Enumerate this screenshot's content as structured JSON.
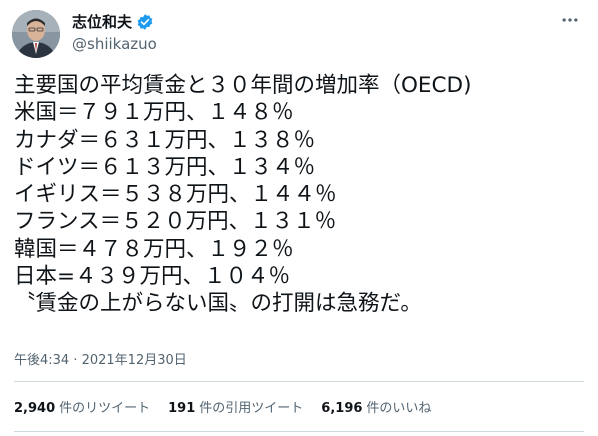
{
  "author": {
    "display_name": "志位和夫",
    "handle": "@shiikazuo",
    "verified_badge_color": "#1d9bf0",
    "avatar": "user-portrait",
    "more_icon": "more-options-icon"
  },
  "tweet": {
    "lines": [
      "主要国の平均賃金と３０年間の増加率（OECD)",
      "米国＝７９１万円、１４８％",
      "カナダ＝６３１万円、１３８％",
      "ドイツ＝６１３万円、１３４％",
      "イギリス＝５３８万円、１４４％",
      "フランス＝５２０万円、１３１％",
      "韓国＝４７８万円、１９２％",
      "日本=４３９万円、１０４％",
      "〝賃金の上がらない国〟の打開は急務だ。"
    ],
    "timestamp": "午後4:34 · 2021年12月30日"
  },
  "stats": {
    "retweets": {
      "count": "2,940",
      "label": "件のリツイート"
    },
    "quotes": {
      "count": "191",
      "label": "件の引用ツイート"
    },
    "likes": {
      "count": "6,196",
      "label": "件のいいね"
    }
  }
}
